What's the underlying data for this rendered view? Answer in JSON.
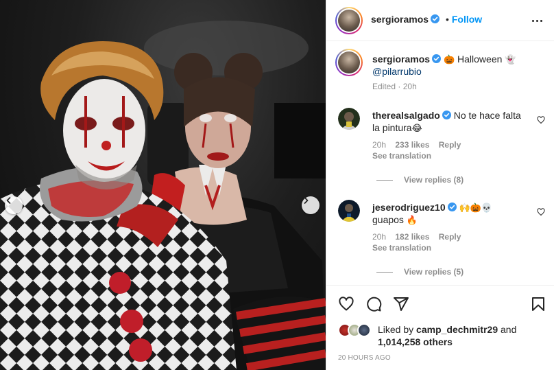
{
  "post": {
    "author": "sergioramos",
    "follow_label": "Follow",
    "separator": "•",
    "caption": {
      "username": "sergioramos",
      "text_emoji_1": "🎃",
      "text": "Halloween",
      "text_emoji_2": "👻",
      "mention": "@pilarrubio",
      "edited": "Edited",
      "dot": "·",
      "age": "20h"
    }
  },
  "comments": [
    {
      "username": "therealsalgado",
      "text_line1": "No te hace falta",
      "text_line2": "la pintura",
      "text_emoji": "😂",
      "age": "20h",
      "likes": "233 likes",
      "reply_label": "Reply",
      "see_translation": "See translation",
      "view_replies": "View replies (8)"
    },
    {
      "username": "jeserodriguez10",
      "emojis": "🙌🎃💀",
      "text": "guapos",
      "text_emoji": "🔥",
      "age": "20h",
      "likes": "182 likes",
      "reply_label": "Reply",
      "see_translation": "See translation",
      "view_replies": "View replies (5)"
    }
  ],
  "likes": {
    "prefix": "Liked by",
    "user": "camp_dechmitr29",
    "and": "and",
    "count": "1,014,258 others"
  },
  "timestamp": "20 HOURS AGO",
  "icons": {
    "verified": "verified-badge-icon",
    "more": "more-options-icon",
    "like": "heart-icon",
    "comment": "comment-icon",
    "share": "share-icon",
    "save": "bookmark-icon",
    "prev": "chevron-left-icon",
    "next": "chevron-right-icon"
  },
  "colors": {
    "accent": "#0095f6",
    "verified": "#3897f0",
    "mention": "#00376b",
    "muted": "#8e8e8e"
  }
}
